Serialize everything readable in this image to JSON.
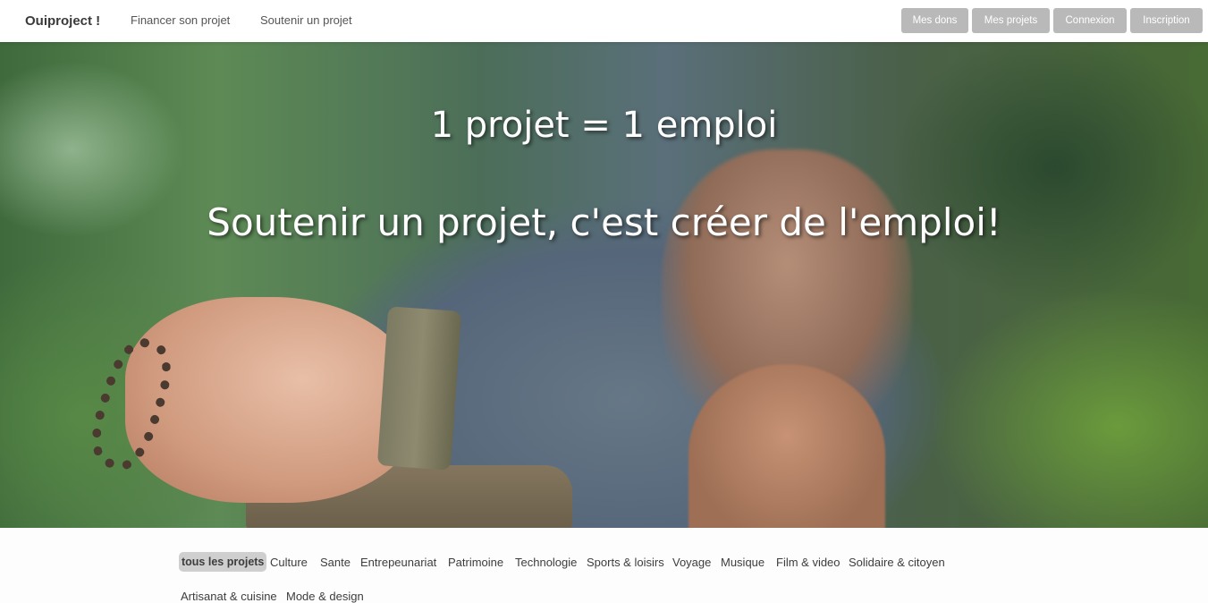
{
  "navbar": {
    "brand": "Ouiproject !",
    "links": [
      "Financer son projet",
      "Soutenir un projet"
    ],
    "buttons": [
      "Mes dons",
      "Mes projets",
      "Connexion",
      "Inscription"
    ],
    "button_color": "#b9b9b9"
  },
  "hero": {
    "line1": "1 projet = 1 emploi",
    "line2": "Soutenir un projet, c'est créer de l'emploi!"
  },
  "categories": {
    "items": [
      "tous les projets",
      "Culture",
      "Sante",
      "Entrepeunariat",
      "Patrimoine",
      "Technologie",
      "Sports & loisirs",
      "Voyage",
      "Musique",
      "Film & video",
      "Solidaire & citoyen",
      "Artisanat & cuisine",
      "Mode & design"
    ],
    "active": "tous les projets",
    "active_color": "#cfcfcf"
  }
}
